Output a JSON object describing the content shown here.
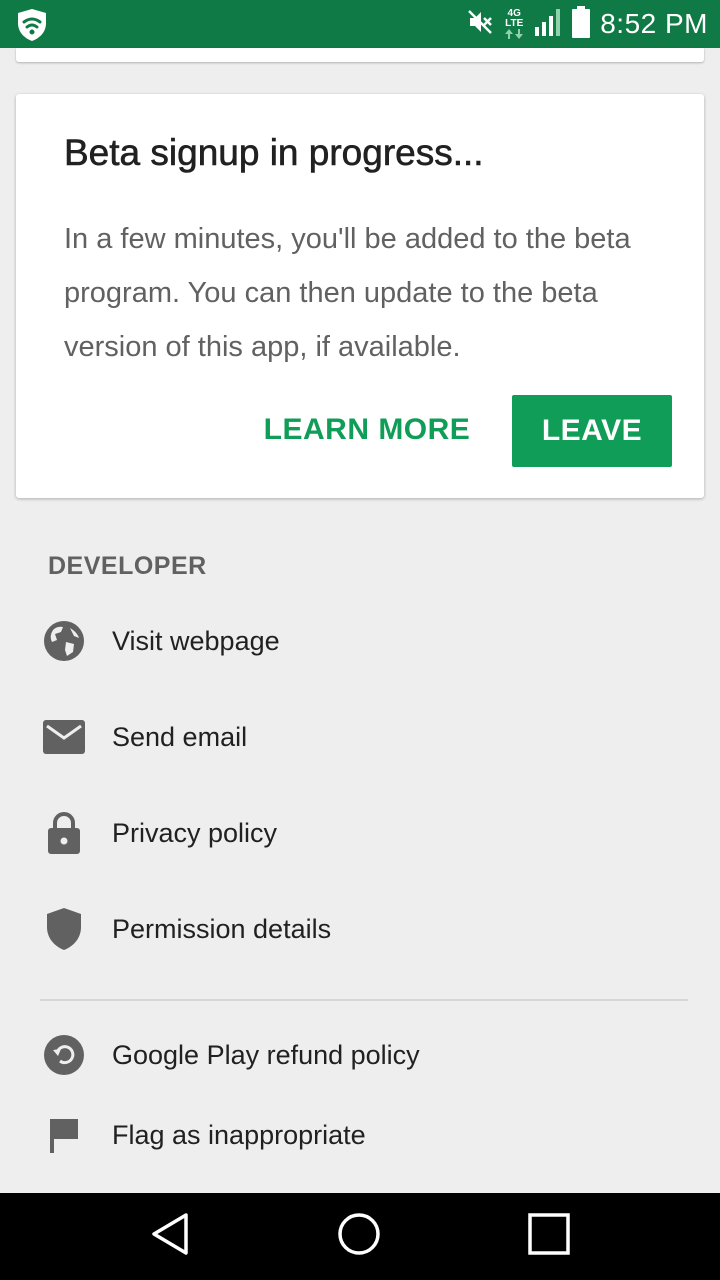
{
  "status_bar": {
    "time": "8:52 PM",
    "network_label": "4G",
    "network_sublabel": "LTE",
    "icons": [
      "shield-logo-icon",
      "muted-speaker-icon",
      "lte-data-icon",
      "signal-icon",
      "battery-icon"
    ],
    "background": "#0f7a45"
  },
  "beta_card": {
    "title": "Beta signup in progress...",
    "body": "In a few minutes, you'll be added to the beta program. You can then update to the beta version of this app, if available.",
    "learn_more_label": "LEARN MORE",
    "leave_label": "LEAVE",
    "accent": "#0f9d58"
  },
  "developer": {
    "header": "DEVELOPER",
    "items": [
      {
        "label": "Visit webpage",
        "icon": "globe-icon"
      },
      {
        "label": "Send email",
        "icon": "email-icon"
      },
      {
        "label": "Privacy policy",
        "icon": "lock-icon"
      },
      {
        "label": "Permission details",
        "icon": "shield-icon"
      }
    ]
  },
  "policy": {
    "items": [
      {
        "label": "Google Play refund policy",
        "icon": "refund-icon"
      },
      {
        "label": "Flag as inappropriate",
        "icon": "flag-icon"
      }
    ]
  },
  "nav_bar": {
    "icons": [
      "back-icon",
      "home-icon",
      "recents-icon"
    ]
  }
}
